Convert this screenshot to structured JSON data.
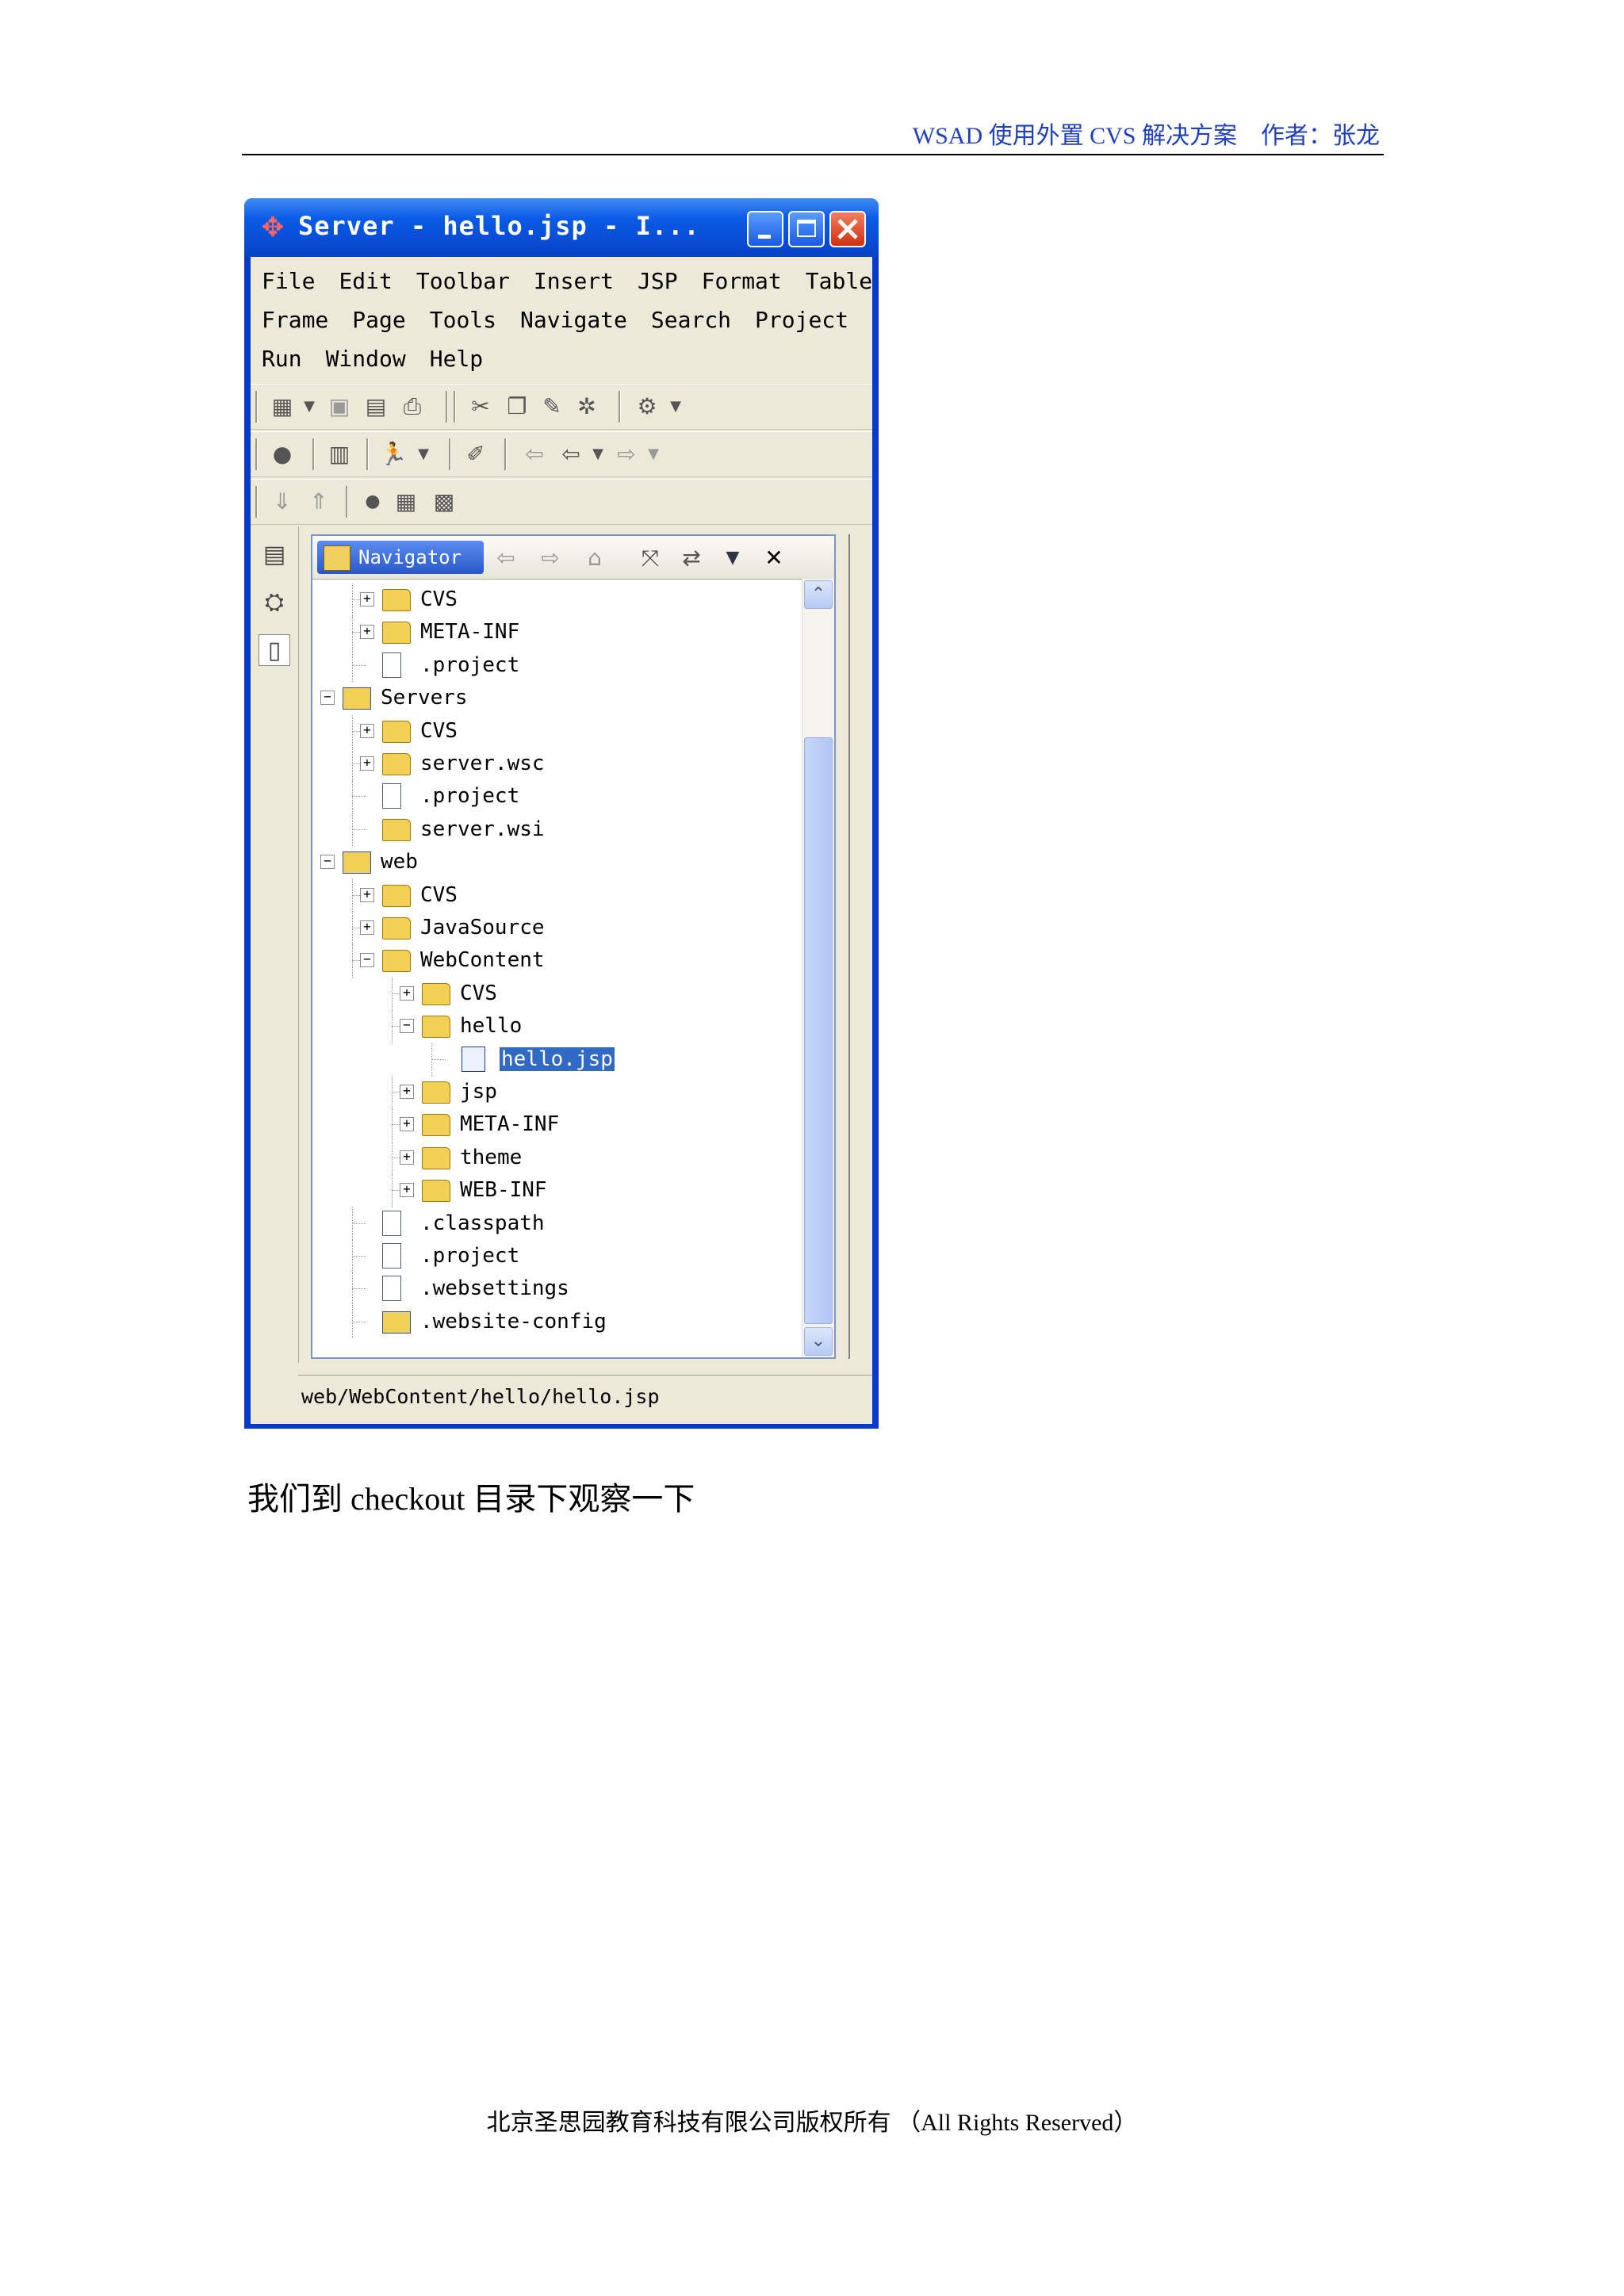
{
  "header": {
    "text": "WSAD 使用外置 CVS 解决方案    作者：张龙"
  },
  "window": {
    "title": "Server - hello.jsp - I...",
    "menu_rows": [
      [
        "File",
        "Edit",
        "Toolbar",
        "Insert",
        "JSP",
        "Format",
        "Table"
      ],
      [
        "Frame",
        "Page",
        "Tools",
        "Navigate",
        "Search",
        "Project"
      ],
      [
        "Run",
        "Window",
        "Help"
      ]
    ],
    "navigator": {
      "tab_label": "Navigator",
      "tree": [
        {
          "label": "CVS",
          "level": 1,
          "icon": "folder-icon",
          "expander": "+"
        },
        {
          "label": "META-INF",
          "level": 1,
          "icon": "folder-icon",
          "expander": "+"
        },
        {
          "label": ".project",
          "level": 1,
          "icon": "file-icon",
          "expander": ""
        },
        {
          "label": "Servers",
          "level": 0,
          "icon": "project-icon",
          "expander": "-"
        },
        {
          "label": "CVS",
          "level": 1,
          "icon": "folder-icon",
          "expander": "+"
        },
        {
          "label": "server.wsc",
          "level": 1,
          "icon": "folder-icon",
          "expander": "+"
        },
        {
          "label": ".project",
          "level": 1,
          "icon": "file-icon",
          "expander": ""
        },
        {
          "label": "server.wsi",
          "level": 1,
          "icon": "folder-icon",
          "expander": ""
        },
        {
          "label": "web",
          "level": 0,
          "icon": "project-icon",
          "expander": "-"
        },
        {
          "label": "CVS",
          "level": 1,
          "icon": "folder-icon",
          "expander": "+"
        },
        {
          "label": "JavaSource",
          "level": 1,
          "icon": "folder-icon",
          "expander": "+"
        },
        {
          "label": "WebContent",
          "level": 1,
          "icon": "folder-icon",
          "expander": "-"
        },
        {
          "label": "CVS",
          "level": 2,
          "icon": "folder-icon",
          "expander": "+"
        },
        {
          "label": "hello",
          "level": 2,
          "icon": "folder-icon",
          "expander": "-"
        },
        {
          "label": "hello.jsp",
          "level": 3,
          "icon": "jsp-file-icon",
          "expander": "",
          "selected": true
        },
        {
          "label": "jsp",
          "level": 2,
          "icon": "folder-icon",
          "expander": "+"
        },
        {
          "label": "META-INF",
          "level": 2,
          "icon": "folder-icon",
          "expander": "+"
        },
        {
          "label": "theme",
          "level": 2,
          "icon": "folder-icon",
          "expander": "+"
        },
        {
          "label": "WEB-INF",
          "level": 2,
          "icon": "folder-icon",
          "expander": "+"
        },
        {
          "label": ".classpath",
          "level": 1,
          "icon": "file-icon",
          "expander": ""
        },
        {
          "label": ".project",
          "level": 1,
          "icon": "file-icon",
          "expander": ""
        },
        {
          "label": ".websettings",
          "level": 1,
          "icon": "file-icon",
          "expander": ""
        },
        {
          "label": ".website-config",
          "level": 1,
          "icon": "website-config-icon",
          "expander": ""
        }
      ]
    },
    "status_path": "web/WebContent/hello/hello.jsp"
  },
  "caption": "我们到 checkout 目录下观察一下",
  "footer": "北京圣思园教育科技有限公司版权所有  （All Rights Reserved）"
}
